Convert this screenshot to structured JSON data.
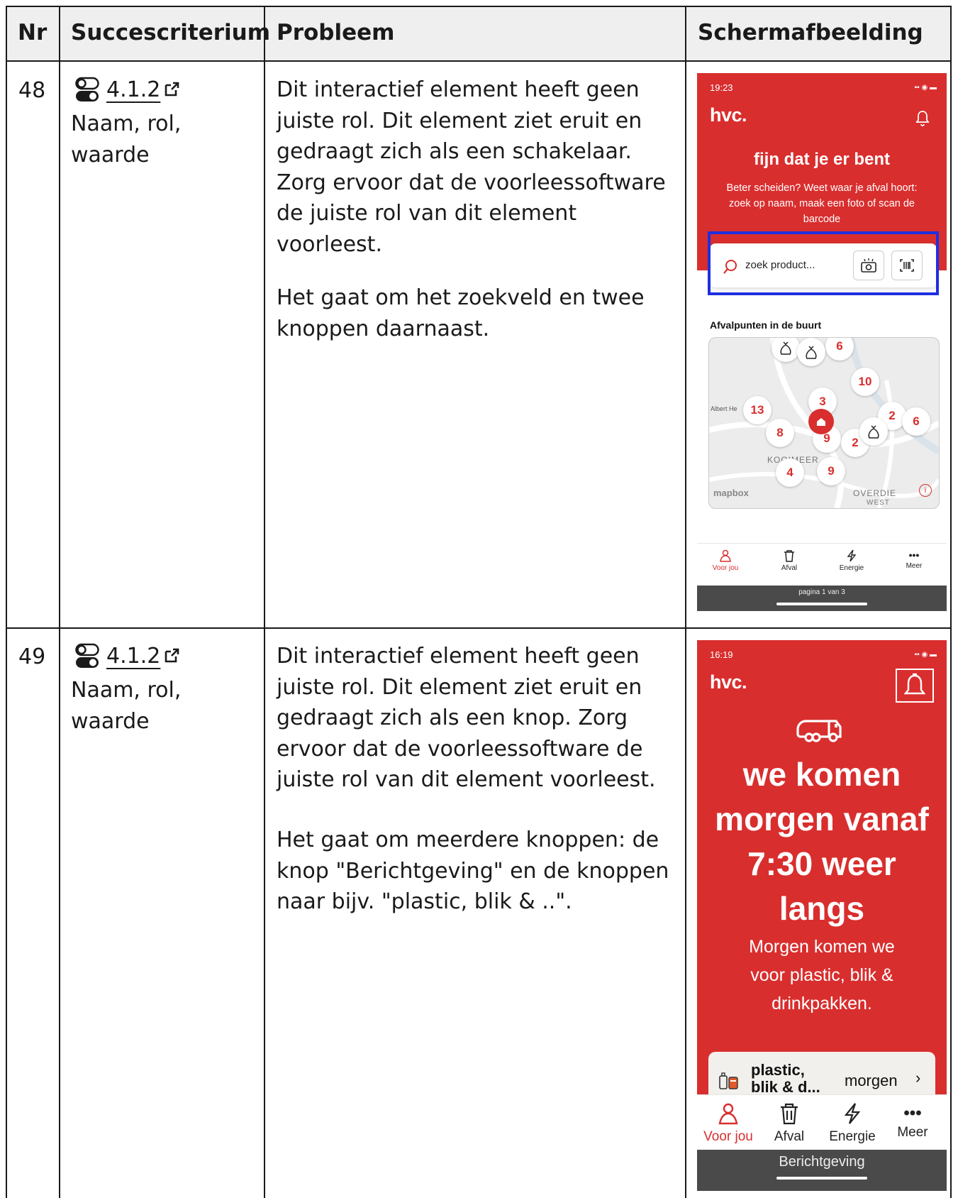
{
  "header": {
    "nr": "Nr",
    "criterion": "Succescriterium",
    "problem": "Probleem",
    "screenshot": "Schermafbeelding"
  },
  "rows": [
    {
      "nr": "48",
      "criterion_code": "4.1.2",
      "criterion_name": "Naam, rol, waarde",
      "problem_p1": "Dit interactief element heeft geen juiste rol. Dit element ziet eruit en gedraagt zich als een schakelaar. Zorg ervoor dat de voorleessoftware de juiste rol van dit element voorleest.",
      "problem_p2": "Het gaat om het zoekveld en twee knoppen daarnaast.",
      "screen": {
        "time": "19:23",
        "brand": "hvc.",
        "greeting": "fijn dat je er bent",
        "subtext": "Beter scheiden? Weet waar je afval hoort: zoek op naam, maak een foto of scan de barcode",
        "search_placeholder": "zoek product...",
        "section_title": "Afvalpunten in de buurt",
        "map_pins": [
          "6",
          "10",
          "3",
          "13",
          "2",
          "6",
          "8",
          "9",
          "2",
          "4",
          "9"
        ],
        "map_labels": {
          "street": "Albert He",
          "district": "KOOIMEER",
          "district2": "OVERDIE",
          "district2_sub": "WEST",
          "attribution": "mapbox"
        },
        "nav": [
          "Voor jou",
          "Afval",
          "Energie",
          "Meer"
        ],
        "page_indicator": "pagina 1 van 3",
        "highlight_color": "#1f2fe0"
      }
    },
    {
      "nr": "49",
      "criterion_code": "4.1.2",
      "criterion_name": "Naam, rol, waarde",
      "problem_p1": "Dit interactief element heeft geen juiste rol. Dit element ziet eruit en gedraagt zich als een knop. Zorg ervoor dat de voorleessoftware de juiste rol van dit element voorleest.",
      "problem_p2": "Het gaat om meerdere knoppen: de knop \"Berichtgeving\" en de knoppen naar bijv. \"plastic, blik & ..\".",
      "screen": {
        "time": "16:19",
        "brand": "hvc.",
        "headline": "we komen morgen vanaf 7:30 weer langs",
        "subtext": "Morgen komen we voor plastic, blik & drinkpakken.",
        "card_title": "plastic, blik & d...",
        "card_when": "morgen",
        "nav": [
          "Voor jou",
          "Afval",
          "Energie",
          "Meer"
        ],
        "bottom_label": "Berichtgeving"
      }
    }
  ],
  "colors": {
    "brand_red": "#d92e2e",
    "header_bg": "#efefef"
  }
}
